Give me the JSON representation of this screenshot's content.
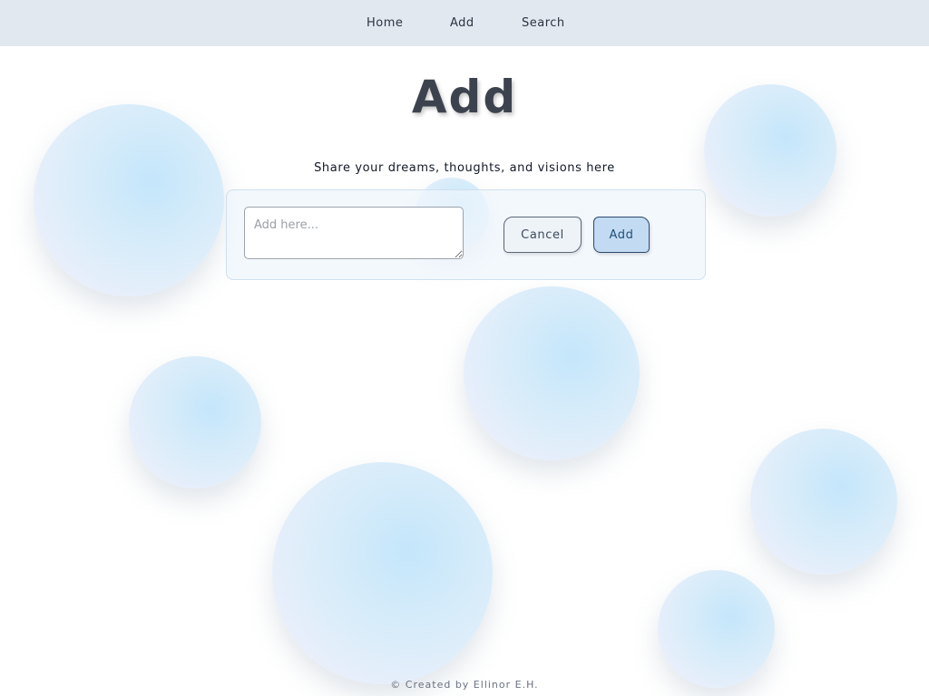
{
  "nav": {
    "items": [
      {
        "label": "Home"
      },
      {
        "label": "Add"
      },
      {
        "label": "Search"
      }
    ]
  },
  "page": {
    "title": "Add",
    "subtitle": "Share your dreams, thoughts, and visions here"
  },
  "form": {
    "input_value": "",
    "input_placeholder": "Add here...",
    "cancel_label": "Cancel",
    "add_label": "Add"
  },
  "footer": {
    "text": "© Created by Ellinor E.H."
  },
  "colors": {
    "nav_background": "#e1e8f0",
    "title": "#3d434e",
    "bubble_blue": "#c4e6fb",
    "bubble_lavender": "#f3effd",
    "add_button_background": "#c3dbf2"
  }
}
